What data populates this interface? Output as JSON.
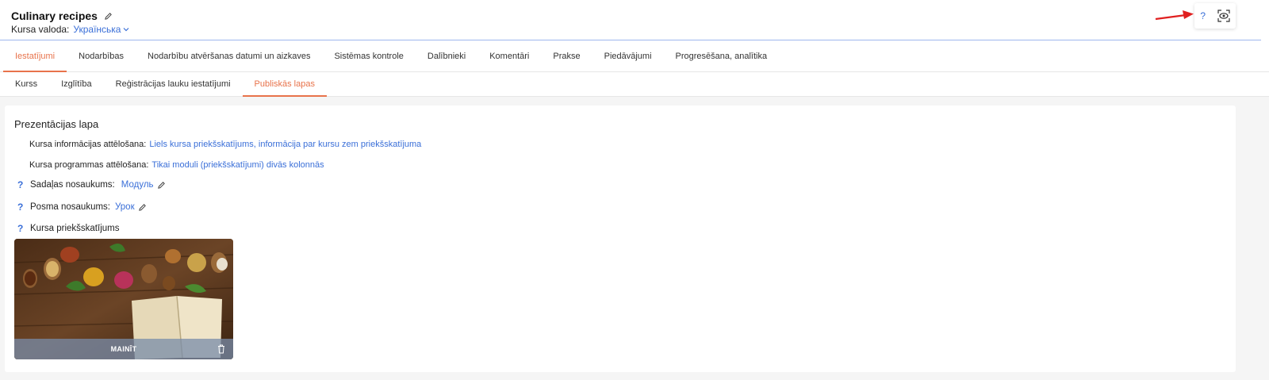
{
  "header": {
    "title": "Culinary recipes",
    "language_label": "Kursa valoda:",
    "language_value": "Українська",
    "help": "?"
  },
  "tabs_main": [
    {
      "label": "Iestatījumi",
      "active": true
    },
    {
      "label": "Nodarbības",
      "active": false
    },
    {
      "label": "Nodarbību atvēršanas datumi un aizkaves",
      "active": false
    },
    {
      "label": "Sistēmas kontrole",
      "active": false
    },
    {
      "label": "Dalībnieki",
      "active": false
    },
    {
      "label": "Komentāri",
      "active": false
    },
    {
      "label": "Prakse",
      "active": false
    },
    {
      "label": "Piedāvājumi",
      "active": false
    },
    {
      "label": "Progresēšana, analītika",
      "active": false
    }
  ],
  "tabs_sub": [
    {
      "label": "Kurss",
      "active": false
    },
    {
      "label": "Izglītība",
      "active": false
    },
    {
      "label": "Reģistrācijas lauku iestatījumi",
      "active": false
    },
    {
      "label": "Publiskās lapas",
      "active": true
    }
  ],
  "panel": {
    "title": "Prezentācijas lapa",
    "info_label": "Kursa informācijas attēlošana:",
    "info_value": "Liels kursa priekšskatījums, informācija par kursu zem priekšskatījuma",
    "program_label": "Kursa programmas attēlošana:",
    "program_value": "Tikai moduli (priekšskatījumi) divās kolonnās",
    "section_label": "Sadaļas nosaukums:",
    "section_value": "Модуль",
    "step_label": "Posma nosaukums:",
    "step_value": "Урок",
    "preview_label": "Kursa priekšskatījums",
    "change_button": "MAINĪT",
    "q": "?"
  },
  "colors": {
    "accent": "#e8734b",
    "link": "#3a6fd8"
  }
}
